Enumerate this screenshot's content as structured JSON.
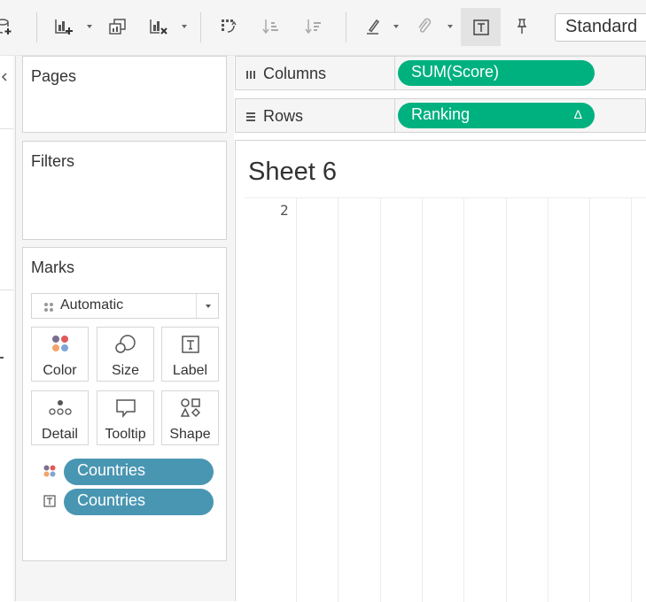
{
  "toolbar": {
    "buttons": [
      {
        "name": "new-data-source-icon"
      },
      {
        "name": "new-worksheet-icon"
      },
      {
        "name": "duplicate-sheet-icon"
      },
      {
        "name": "clear-sheet-icon"
      },
      {
        "name": "swap-rows-columns-icon"
      },
      {
        "name": "sort-ascending-icon"
      },
      {
        "name": "sort-descending-icon"
      },
      {
        "name": "highlight-icon"
      },
      {
        "name": "group-members-icon"
      },
      {
        "name": "show-mark-labels-icon"
      },
      {
        "name": "fix-axes-icon"
      }
    ],
    "fit_select": "Standard"
  },
  "cards": {
    "pages_title": "Pages",
    "filters_title": "Filters",
    "marks_title": "Marks"
  },
  "marks": {
    "mark_type": "Automatic",
    "buttons": {
      "color": "Color",
      "size": "Size",
      "label": "Label",
      "detail": "Detail",
      "tooltip": "Tooltip",
      "shape": "Shape"
    },
    "fields": [
      {
        "icon": "color-encoding-icon",
        "label": "Countries"
      },
      {
        "icon": "label-encoding-icon",
        "label": "Countries"
      }
    ]
  },
  "shelves": {
    "columns_label": "Columns",
    "columns_pill": "SUM(Score)",
    "rows_label": "Rows",
    "rows_pill": "Ranking",
    "rows_pill_marker": "Δ"
  },
  "sheet": {
    "title": "Sheet 6",
    "row_header": "2"
  },
  "colors": {
    "measure_pill": "#00b180",
    "dimension_pill": "#4996b2"
  }
}
